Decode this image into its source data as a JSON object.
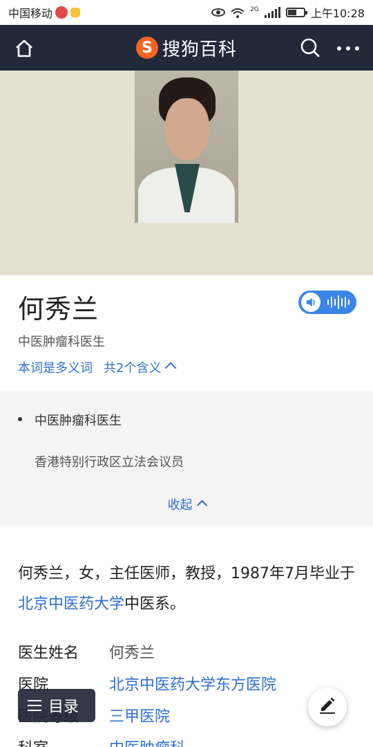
{
  "status_bar": {
    "carrier": "中国移动",
    "network": "2G",
    "time": "上午10:28",
    "battery_level": 0.55
  },
  "header": {
    "logo_letter": "S",
    "brand": "搜狗百科",
    "icons": [
      "home-icon",
      "search-icon",
      "more-icon"
    ]
  },
  "entry": {
    "title": "何秀兰",
    "subtitle": "中医肿瘤科医生",
    "polysemy_label": "本词是多义词",
    "polysemy_count": "共2个含义",
    "meanings": [
      "中医肿瘤科医生",
      "香港特别行政区立法会议员"
    ],
    "collapse_label": "收起"
  },
  "intro": {
    "text_before": "何秀兰，女，主任医师，教授，1987年7月毕业于",
    "link": "北京中医药大学",
    "text_after": "中医系。"
  },
  "info": [
    {
      "key": "医生姓名",
      "value": "何秀兰",
      "link": false
    },
    {
      "key": "医院",
      "value": "北京中医药大学东方医院",
      "link": true
    },
    {
      "key": "医院等级",
      "value": "三甲医院",
      "link": true
    },
    {
      "key": "科室",
      "value": "中医肿瘤科",
      "link": true
    }
  ],
  "floating": {
    "toc_label": "目录"
  },
  "colors": {
    "header_bg": "#222a3a",
    "accent": "#2f6fd0",
    "brand_orange": "#f26522",
    "hero_bg": "#e5e0d0"
  }
}
